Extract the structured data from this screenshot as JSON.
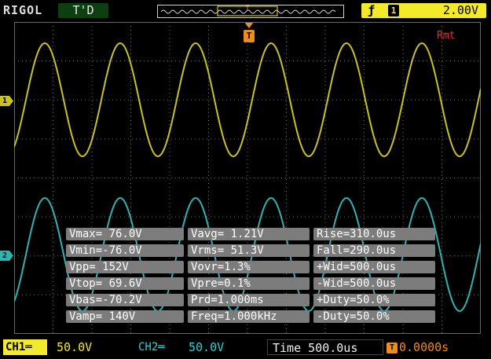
{
  "header": {
    "brand": "RIGOL",
    "status": "T'D",
    "trigger_edge_icon": "rising-edge-icon",
    "trigger_source": "1",
    "trigger_level": "2.00V",
    "remote": "Rmt"
  },
  "markers": {
    "ch1": "1",
    "ch2": "2",
    "trigger": "T"
  },
  "colors": {
    "ch1": "#c9c224",
    "ch2": "#2fb4b4",
    "trigger": "#f08c1c",
    "grid": "#6a6a6a",
    "remote": "#e03030"
  },
  "measurements": [
    [
      "Vmax= 76.0V",
      "Vavg= 1.21V",
      "Rise=310.0us"
    ],
    [
      "Vmin=-76.0V",
      "Vrms= 51.3V",
      "Fall=290.0us"
    ],
    [
      "Vpp= 152V",
      "Vovr=1.3%",
      "+Wid=500.0us"
    ],
    [
      "Vtop= 69.6V",
      "Vpre=0.1%",
      "-Wid=500.0us"
    ],
    [
      "Vbas=-70.2V",
      "Prd=1.000ms",
      "+Duty=50.0%"
    ],
    [
      "Vamp= 140V",
      "Freq=1.000kHz",
      "-Duty=50.0%"
    ]
  ],
  "footer": {
    "ch1_label": "CH1",
    "ch1_coupling_icon": "dc-coupling-icon",
    "ch1_scale": "50.0V",
    "ch2_label": "CH2",
    "ch2_coupling_icon": "dc-coupling-icon",
    "ch2_scale": "50.0V",
    "timebase": "Time 500.0us",
    "trigger_offset": "0.0000s"
  }
}
